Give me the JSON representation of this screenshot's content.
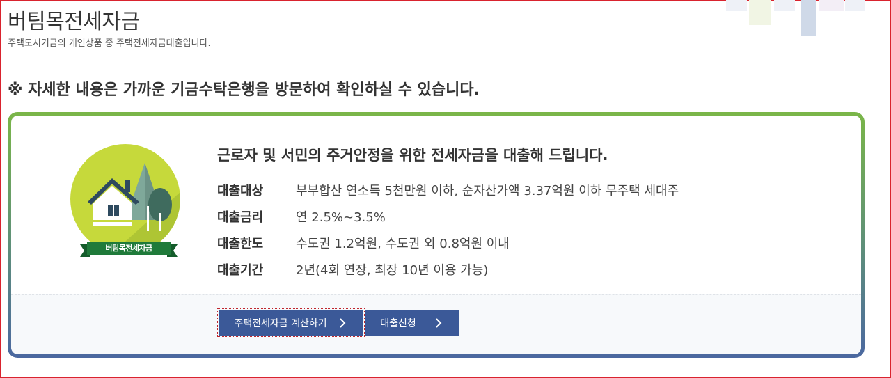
{
  "header": {
    "title": "버팀목전세자금",
    "subtitle": "주택도시기금의 개인상품 중 주택전세자금대출입니다."
  },
  "notice": "※ 자세한 내용은 가까운 기금수탁은행을 방문하여 확인하실 수 있습니다.",
  "product": {
    "badge_label": "버팀목전세자금",
    "headline": "근로자 및 서민의 주거안정을 위한 전세자금을 대출해 드립니다.",
    "details": [
      {
        "label": "대출대상",
        "value": "부부합산 연소득 5천만원 이하, 순자산가액 3.37억원 이하 무주택 세대주"
      },
      {
        "label": "대출금리",
        "value": "연 2.5%~3.5%"
      },
      {
        "label": "대출한도",
        "value": "수도권 1.2억원, 수도권 외 0.8억원 이내"
      },
      {
        "label": "대출기간",
        "value": "2년(4회 연장, 최장 10년 이용 가능)"
      }
    ]
  },
  "buttons": {
    "calculator": "주택전세자금 계산하기",
    "apply": "대출신청"
  },
  "colors": {
    "card_border_top": "#7ab648",
    "card_border_bottom": "#4b68a0",
    "button": "#3b5998",
    "emblem_circle": "#c6d93b",
    "badge": "#1f7a3a",
    "house": "#2e4a5f"
  },
  "icons": {
    "emblem": "house-tree-emblem-icon",
    "button_arrow": "chevron-right-icon"
  }
}
